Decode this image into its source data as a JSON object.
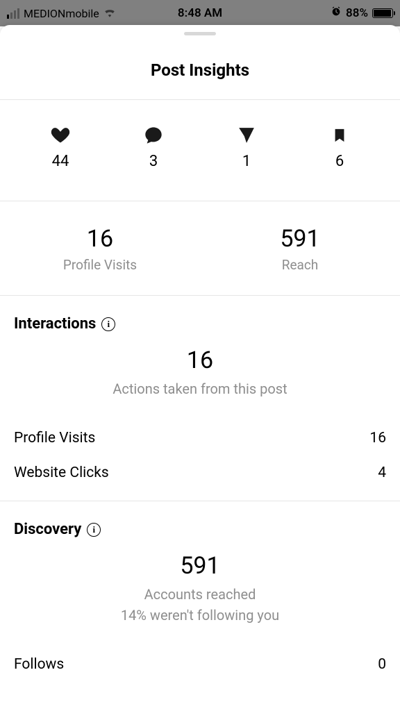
{
  "status": {
    "carrier": "MEDIONmobile",
    "time": "8:48 AM",
    "battery_pct": "88%"
  },
  "sheet": {
    "title": "Post Insights"
  },
  "engagement": {
    "likes": "44",
    "comments": "3",
    "shares": "1",
    "saves": "6"
  },
  "summary": {
    "profile_visits_value": "16",
    "profile_visits_label": "Profile Visits",
    "reach_value": "591",
    "reach_label": "Reach"
  },
  "interactions": {
    "heading": "Interactions",
    "total": "16",
    "subtitle": "Actions taken from this post",
    "rows": {
      "profile_visits_label": "Profile Visits",
      "profile_visits_value": "16",
      "website_clicks_label": "Website Clicks",
      "website_clicks_value": "4"
    }
  },
  "discovery": {
    "heading": "Discovery",
    "total": "591",
    "subtitle1": "Accounts reached",
    "subtitle2": "14% weren't following you",
    "rows": {
      "follows_label": "Follows",
      "follows_value": "0"
    }
  }
}
